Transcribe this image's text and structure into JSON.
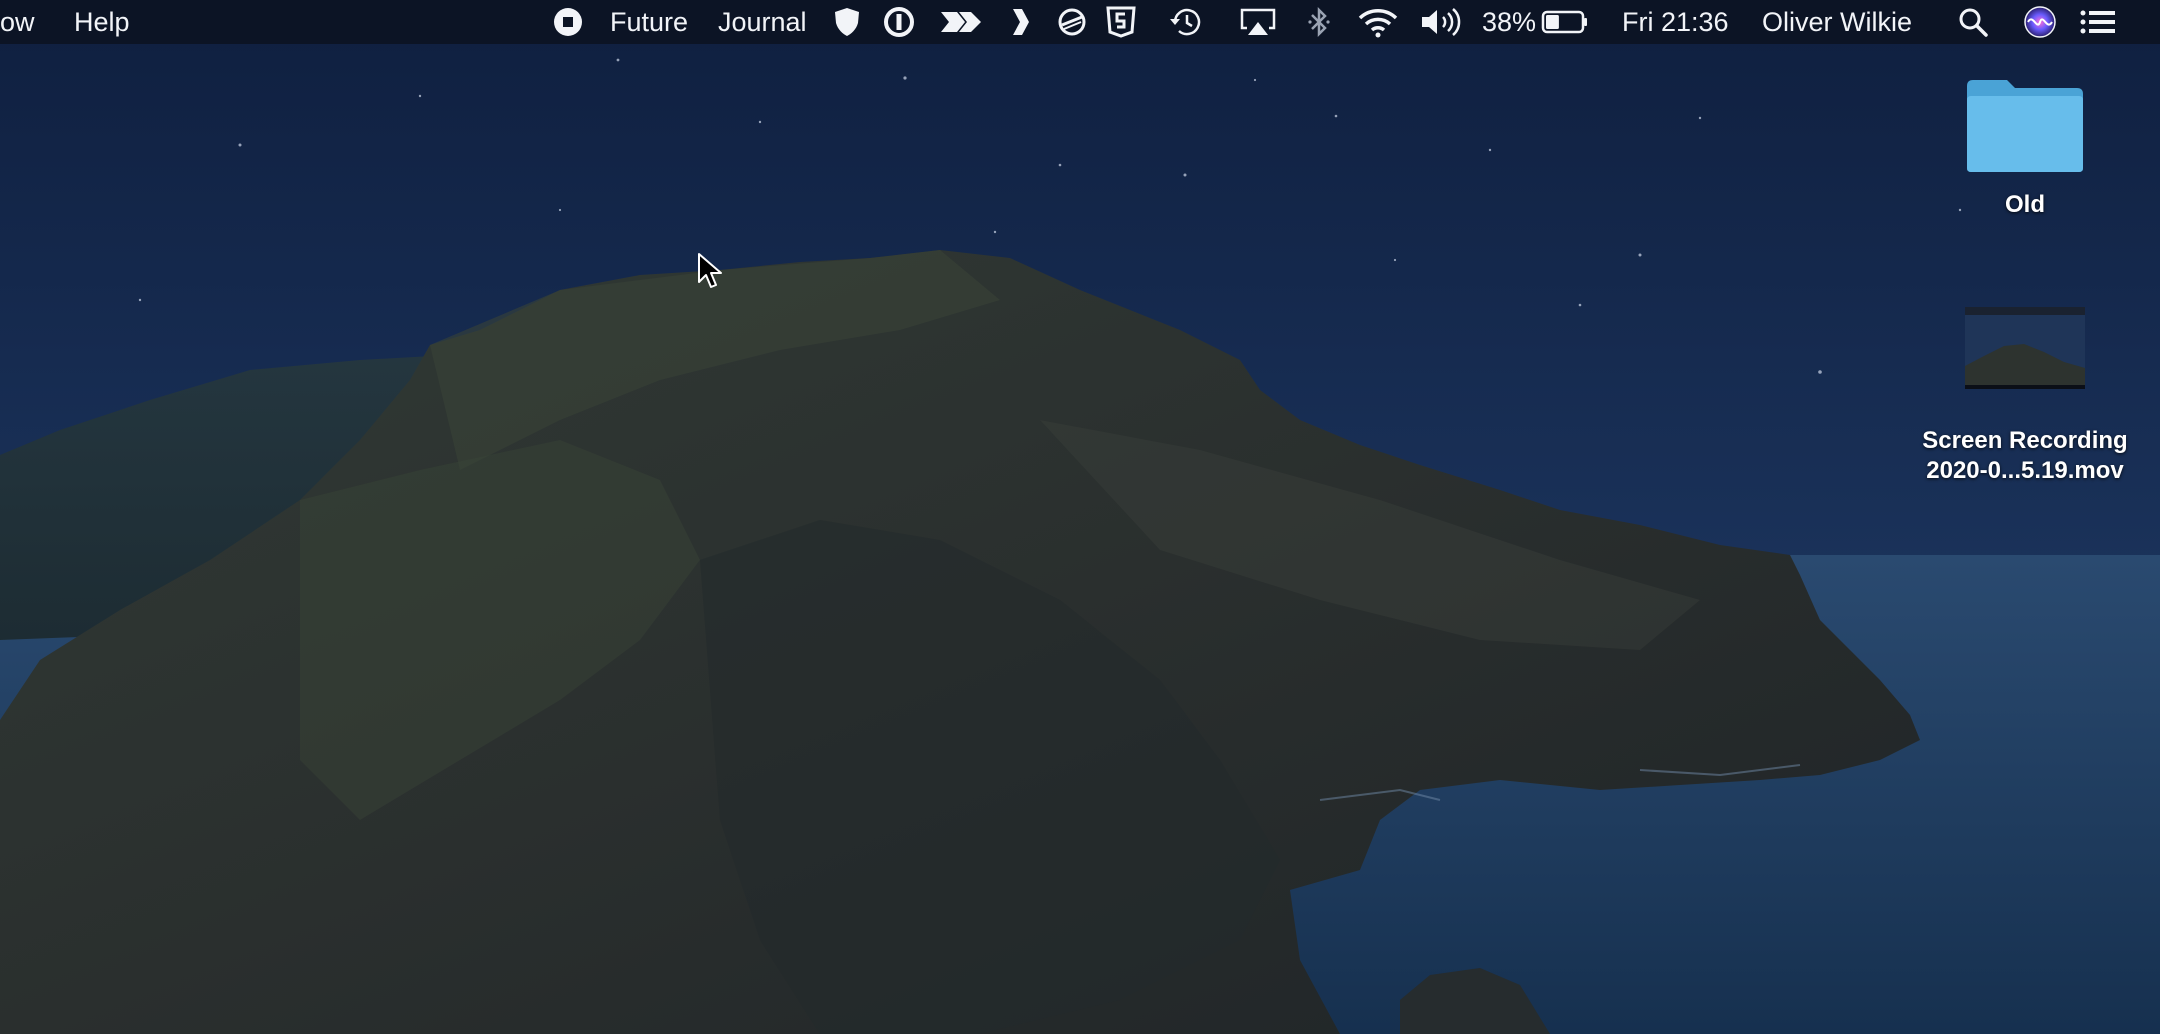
{
  "menubar": {
    "left_items": [
      "ow",
      "Help"
    ],
    "status_items": [
      {
        "icon": "stop-record-icon"
      },
      {
        "label": "Future"
      },
      {
        "label": "Journal"
      },
      {
        "icon": "shield-icon"
      },
      {
        "icon": "one-password-icon"
      },
      {
        "icon": "fast-forward-arrow-icon"
      },
      {
        "icon": "chevron-right-icon"
      },
      {
        "icon": "lines-circle-icon"
      },
      {
        "icon": "html5-badge-icon"
      },
      {
        "icon": "time-machine-icon"
      },
      {
        "icon": "airplay-icon"
      },
      {
        "icon": "bluetooth-icon"
      },
      {
        "icon": "wifi-icon"
      },
      {
        "icon": "volume-icon"
      }
    ],
    "battery_percent": "38%",
    "battery_level": 0.38,
    "clock": "Fri 21:36",
    "user_name": "Oliver Wilkie",
    "right_icons": [
      "spotlight-search-icon",
      "siri-icon",
      "notification-center-icon"
    ]
  },
  "desktop": {
    "items": [
      {
        "type": "folder",
        "label": "Old"
      },
      {
        "type": "video-file",
        "label_line1": "Screen Recording",
        "label_line2": "2020-0...5.19.mov"
      }
    ]
  },
  "colors": {
    "menubar_bg": "#0c1425",
    "menubar_text": "#f2f4f8",
    "sky_top": "#0f1f3f",
    "sky_bottom": "#1e3b68",
    "sea": "#1d3a5e",
    "island": "#2c322f",
    "folder": "#5fb6e8"
  }
}
